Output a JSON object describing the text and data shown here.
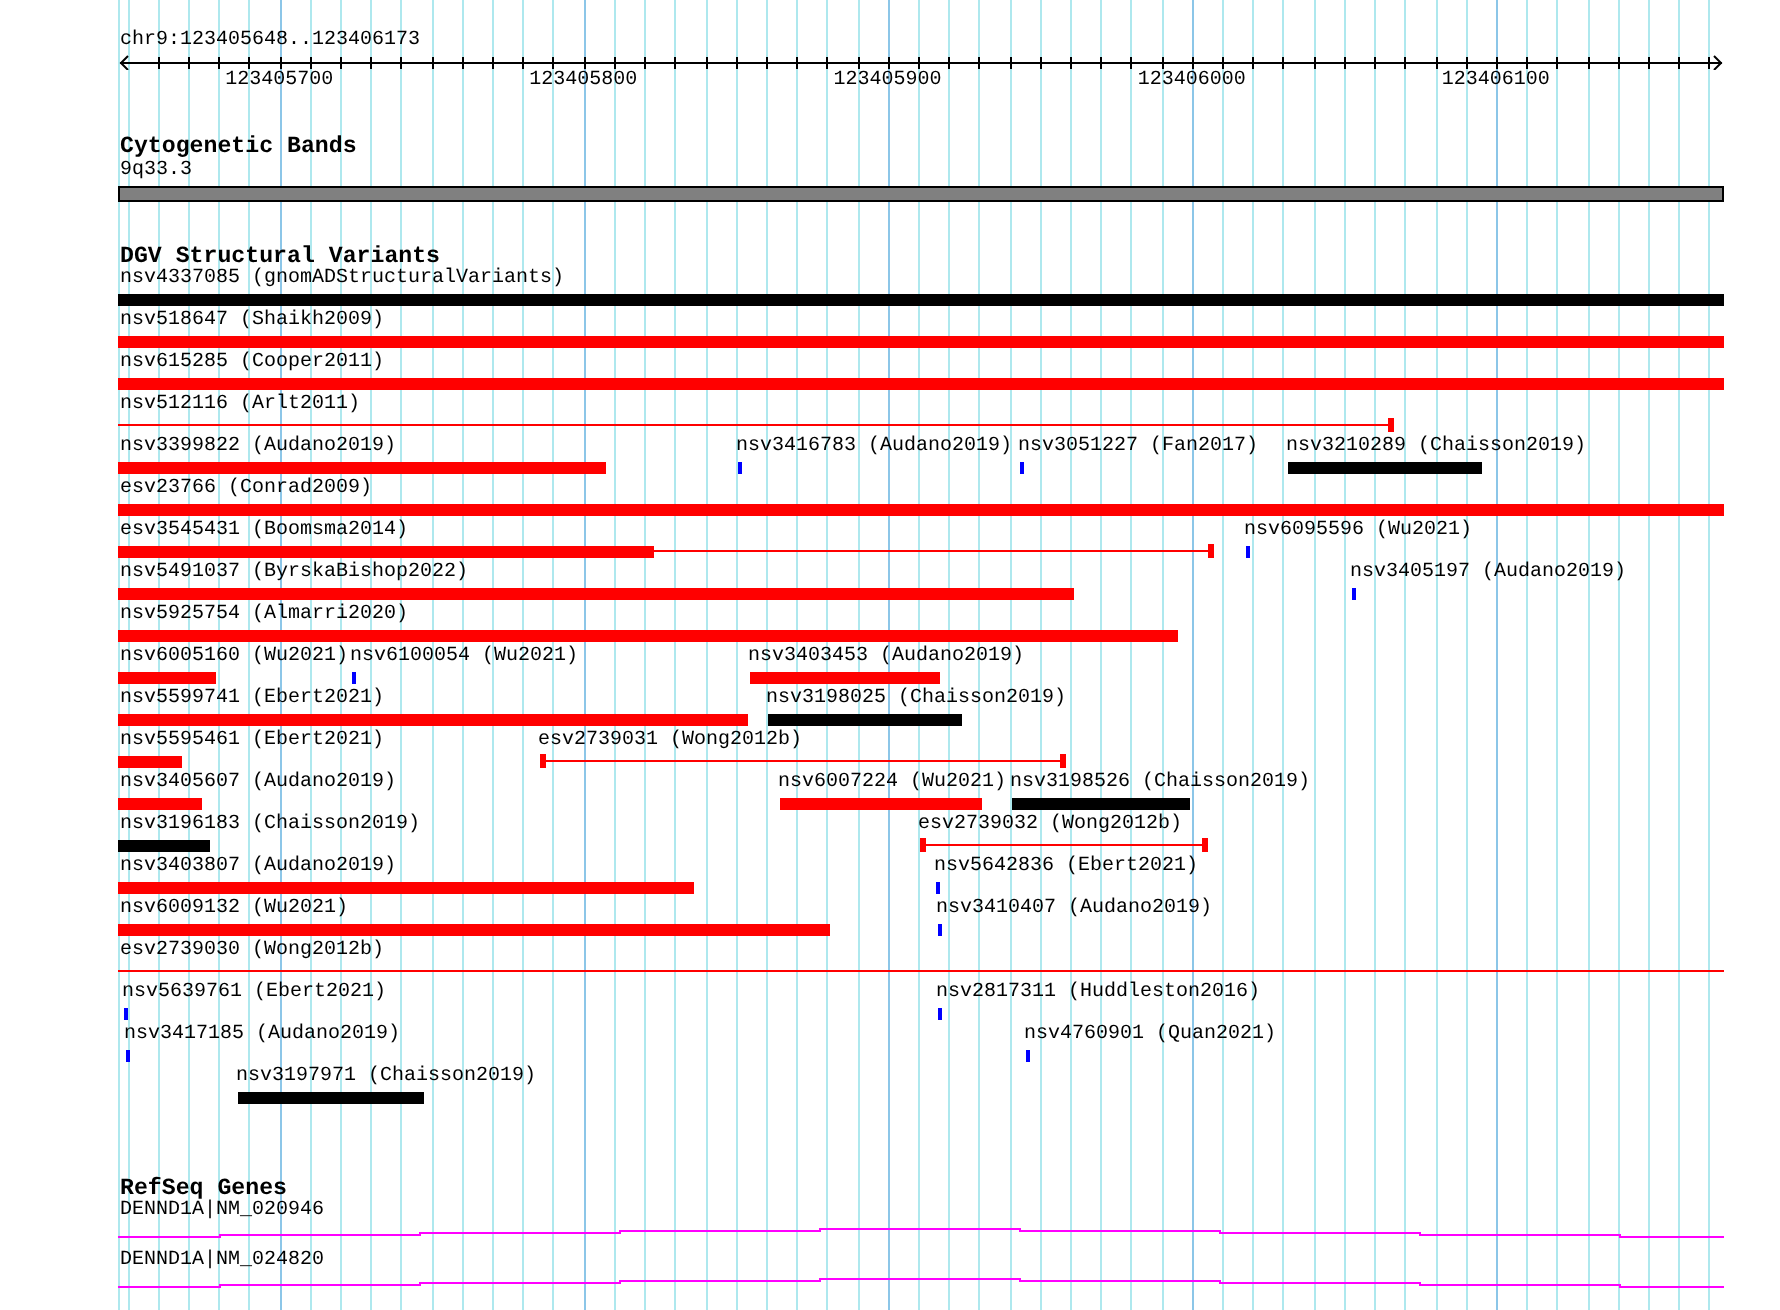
{
  "ruler": {
    "region": "chr9:123405648..123406173",
    "ticks": [
      "123405700",
      "123405800",
      "123405900",
      "123406000",
      "123406100"
    ]
  },
  "tracks": [
    {
      "kind": "cytoband",
      "title": "Cytogenetic Bands",
      "bands": [
        {
          "name": "9q33.3"
        }
      ]
    },
    {
      "kind": "variants",
      "title": "DGV Structural Variants",
      "rows": [
        {
          "features": [
            {
              "label": "nsv4337085 (gnomADStructuralVariants)",
              "kind": "bar",
              "color": "#000000"
            }
          ]
        },
        {
          "features": [
            {
              "label": "nsv518647 (Shaikh2009)",
              "kind": "bar",
              "color": "#ff0000"
            }
          ]
        },
        {
          "features": [
            {
              "label": "nsv615285 (Cooper2011)",
              "kind": "bar",
              "color": "#ff0000"
            }
          ]
        },
        {
          "features": [
            {
              "label": "nsv512116 (Arlt2011)",
              "kind": "range",
              "color": "#ff0000"
            }
          ]
        },
        {
          "features": [
            {
              "label": "nsv3399822 (Audano2019)",
              "kind": "bar",
              "color": "#ff0000"
            },
            {
              "label": "nsv3416783 (Audano2019)",
              "kind": "bar",
              "color": "#0000ff"
            },
            {
              "label": "nsv3051227 (Fan2017)",
              "kind": "bar",
              "color": "#0000ff"
            },
            {
              "label": "nsv3210289 (Chaisson2019)",
              "kind": "bar",
              "color": "#000000"
            }
          ]
        },
        {
          "features": [
            {
              "label": "esv23766 (Conrad2009)",
              "kind": "bar",
              "color": "#ff0000"
            }
          ]
        },
        {
          "features": [
            {
              "label": "esv3545431 (Boomsma2014)",
              "kind": "range",
              "color": "#ff0000"
            },
            {
              "label": "nsv6095596 (Wu2021)",
              "kind": "bar",
              "color": "#0000ff"
            }
          ]
        },
        {
          "features": [
            {
              "label": "nsv5491037 (ByrskaBishop2022)",
              "kind": "bar",
              "color": "#ff0000"
            },
            {
              "label": "nsv3405197 (Audano2019)",
              "kind": "bar",
              "color": "#0000ff"
            }
          ]
        },
        {
          "features": [
            {
              "label": "nsv5925754 (Almarri2020)",
              "kind": "bar",
              "color": "#ff0000"
            }
          ]
        },
        {
          "features": [
            {
              "label": "nsv6005160 (Wu2021)",
              "kind": "bar",
              "color": "#ff0000"
            },
            {
              "label": "nsv6100054 (Wu2021)",
              "kind": "bar",
              "color": "#0000ff"
            },
            {
              "label": "nsv3403453 (Audano2019)",
              "kind": "bar",
              "color": "#ff0000"
            }
          ]
        },
        {
          "features": [
            {
              "label": "nsv5599741 (Ebert2021)",
              "kind": "bar",
              "color": "#ff0000"
            },
            {
              "label": "nsv3198025 (Chaisson2019)",
              "kind": "bar",
              "color": "#000000"
            }
          ]
        },
        {
          "features": [
            {
              "label": "nsv5595461 (Ebert2021)",
              "kind": "bar",
              "color": "#ff0000"
            },
            {
              "label": "esv2739031 (Wong2012b)",
              "kind": "range",
              "color": "#ff0000"
            }
          ]
        },
        {
          "features": [
            {
              "label": "nsv3405607 (Audano2019)",
              "kind": "bar",
              "color": "#ff0000"
            },
            {
              "label": "nsv6007224 (Wu2021)",
              "kind": "bar",
              "color": "#ff0000"
            },
            {
              "label": "nsv3198526 (Chaisson2019)",
              "kind": "bar",
              "color": "#000000"
            }
          ]
        },
        {
          "features": [
            {
              "label": "nsv3196183 (Chaisson2019)",
              "kind": "bar",
              "color": "#000000"
            },
            {
              "label": "esv2739032 (Wong2012b)",
              "kind": "range",
              "color": "#ff0000"
            }
          ]
        },
        {
          "features": [
            {
              "label": "nsv3403807 (Audano2019)",
              "kind": "bar",
              "color": "#ff0000"
            },
            {
              "label": "nsv5642836 (Ebert2021)",
              "kind": "bar",
              "color": "#0000ff"
            }
          ]
        },
        {
          "features": [
            {
              "label": "nsv6009132 (Wu2021)",
              "kind": "bar",
              "color": "#ff0000"
            },
            {
              "label": "nsv3410407 (Audano2019)",
              "kind": "bar",
              "color": "#0000ff"
            }
          ]
        },
        {
          "features": [
            {
              "label": "esv2739030 (Wong2012b)",
              "kind": "range",
              "color": "#ff0000"
            }
          ]
        },
        {
          "features": [
            {
              "label": "nsv5639761 (Ebert2021)",
              "kind": "bar",
              "color": "#0000ff"
            },
            {
              "label": "nsv2817311 (Huddleston2016)",
              "kind": "bar",
              "color": "#0000ff"
            }
          ]
        },
        {
          "features": [
            {
              "label": "nsv3417185 (Audano2019)",
              "kind": "bar",
              "color": "#0000ff"
            },
            {
              "label": "nsv4760901 (Quan2021)",
              "kind": "bar",
              "color": "#0000ff"
            }
          ]
        },
        {
          "features": [
            {
              "label": "nsv3197971 (Chaisson2019)",
              "kind": "bar",
              "color": "#000000"
            }
          ]
        }
      ]
    },
    {
      "kind": "genes",
      "title": "RefSeq Genes",
      "genes": [
        {
          "name": "DENND1A|NM_020946"
        },
        {
          "name": "DENND1A|NM_024820"
        }
      ]
    }
  ]
}
